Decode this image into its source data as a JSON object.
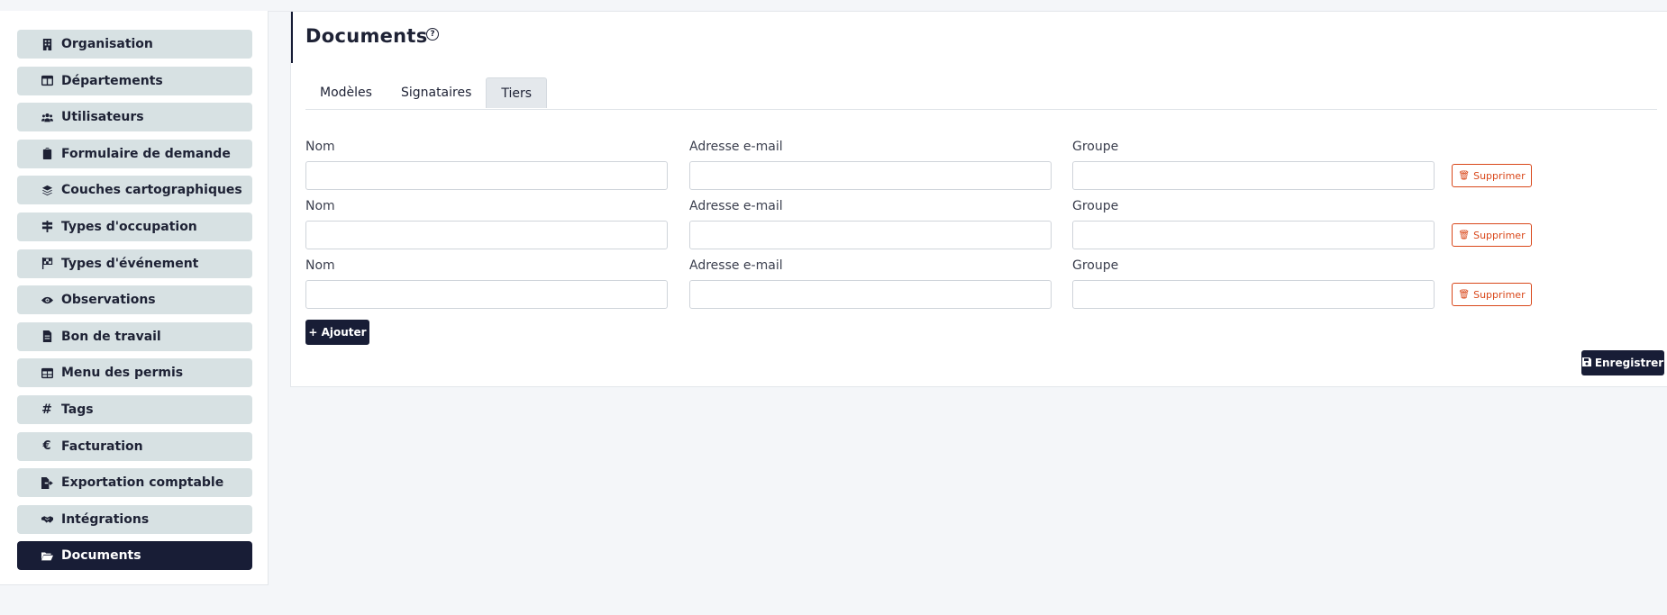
{
  "sidebar": {
    "items": [
      {
        "label": "Organisation",
        "icon": "building-icon"
      },
      {
        "label": "Départements",
        "icon": "columns-icon"
      },
      {
        "label": "Utilisateurs",
        "icon": "users-icon"
      },
      {
        "label": "Formulaire de demande",
        "icon": "clipboard-icon"
      },
      {
        "label": "Couches cartographiques",
        "icon": "layers-icon"
      },
      {
        "label": "Types d'occupation",
        "icon": "signpost-icon"
      },
      {
        "label": "Types d'événement",
        "icon": "flag-checkered-icon"
      },
      {
        "label": "Observations",
        "icon": "eye-icon"
      },
      {
        "label": "Bon de travail",
        "icon": "file-icon"
      },
      {
        "label": "Menu des permis",
        "icon": "table-icon"
      },
      {
        "label": "Tags",
        "icon": "hashtag-icon"
      },
      {
        "label": "Facturation",
        "icon": "euro-icon"
      },
      {
        "label": "Exportation comptable",
        "icon": "file-export-icon"
      },
      {
        "label": "Intégrations",
        "icon": "handshake-icon"
      },
      {
        "label": "Documents",
        "icon": "folder-open-icon",
        "active": true
      }
    ]
  },
  "page": {
    "title": "Documents",
    "help_icon": "?"
  },
  "tabs": [
    {
      "label": "Modèles"
    },
    {
      "label": "Signataires"
    },
    {
      "label": "Tiers",
      "active": true
    }
  ],
  "form": {
    "labels": {
      "name": "Nom",
      "email": "Adresse e-mail",
      "group": "Groupe"
    },
    "rows": [
      {
        "name": "",
        "email": "",
        "group": "",
        "delete_label": "Supprimer"
      },
      {
        "name": "",
        "email": "",
        "group": "",
        "delete_label": "Supprimer"
      },
      {
        "name": "",
        "email": "",
        "group": "",
        "delete_label": "Supprimer"
      }
    ],
    "add_label": "+ Ajouter",
    "save_label": "Enregistrer"
  },
  "colors": {
    "accent": "#181d36",
    "sidebar_item_bg": "#d7e1e3",
    "danger": "#d9471a",
    "page_bg": "#f4f6f9"
  }
}
